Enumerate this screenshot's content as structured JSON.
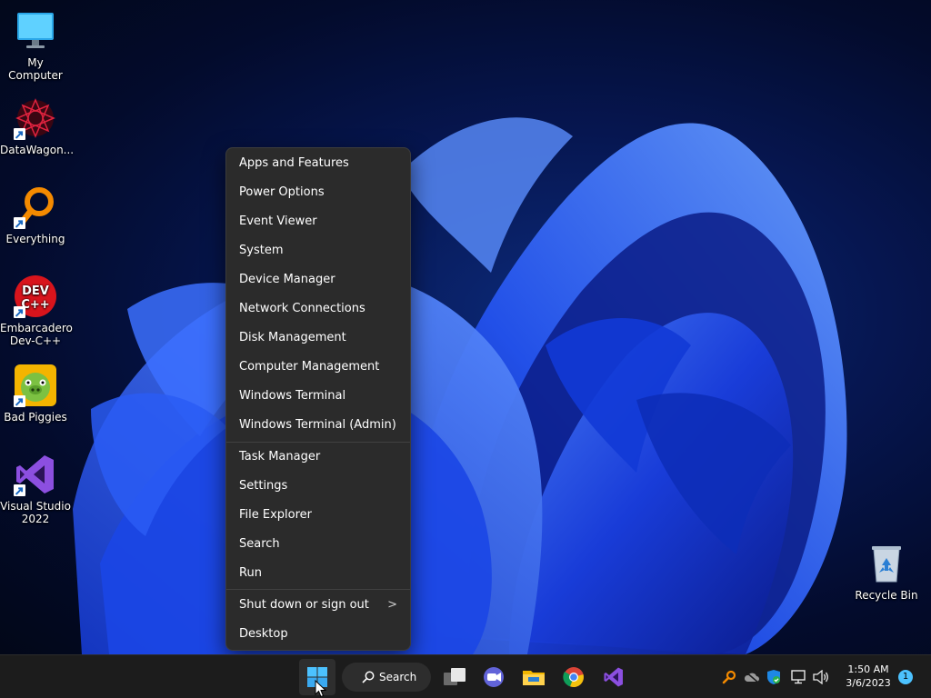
{
  "desktop": {
    "icons": [
      {
        "label": "My Computer",
        "icon": "monitor-icon"
      },
      {
        "label": "DataWagon...",
        "icon": "datawagon-icon"
      },
      {
        "label": "Everything",
        "icon": "everything-search-icon"
      },
      {
        "label": "Embarcadero Dev-C++",
        "icon": "devcpp-icon"
      },
      {
        "label": "Bad Piggies",
        "icon": "bad-piggies-icon"
      },
      {
        "label": "Visual Studio 2022",
        "icon": "visual-studio-icon"
      },
      {
        "label": "Recycle Bin",
        "icon": "recycle-bin-icon"
      }
    ],
    "devcpp_badge": "DEV C++"
  },
  "context_menu": {
    "items": [
      "Apps and Features",
      "Power Options",
      "Event Viewer",
      "System",
      "Device Manager",
      "Network Connections",
      "Disk Management",
      "Computer Management",
      "Windows Terminal",
      "Windows Terminal (Admin)",
      "Task Manager",
      "Settings",
      "File Explorer",
      "Search",
      "Run",
      "Shut down or sign out",
      "Desktop"
    ],
    "submenu_arrow": ">"
  },
  "taskbar": {
    "search_label": "Search",
    "apps": [
      "task-view-icon",
      "teams-icon",
      "file-explorer-icon",
      "chrome-icon",
      "visual-studio-icon"
    ],
    "tray": [
      "everything-tray-icon",
      "onedrive-icon",
      "security-icon",
      "network-icon",
      "volume-icon"
    ],
    "time": "1:50 AM",
    "date": "3/6/2023",
    "notification_count": "1"
  },
  "colors": {
    "accent": "#4cc2ff",
    "menu_bg": "#2b2b2b",
    "taskbar_bg": "#1c1c1c"
  }
}
